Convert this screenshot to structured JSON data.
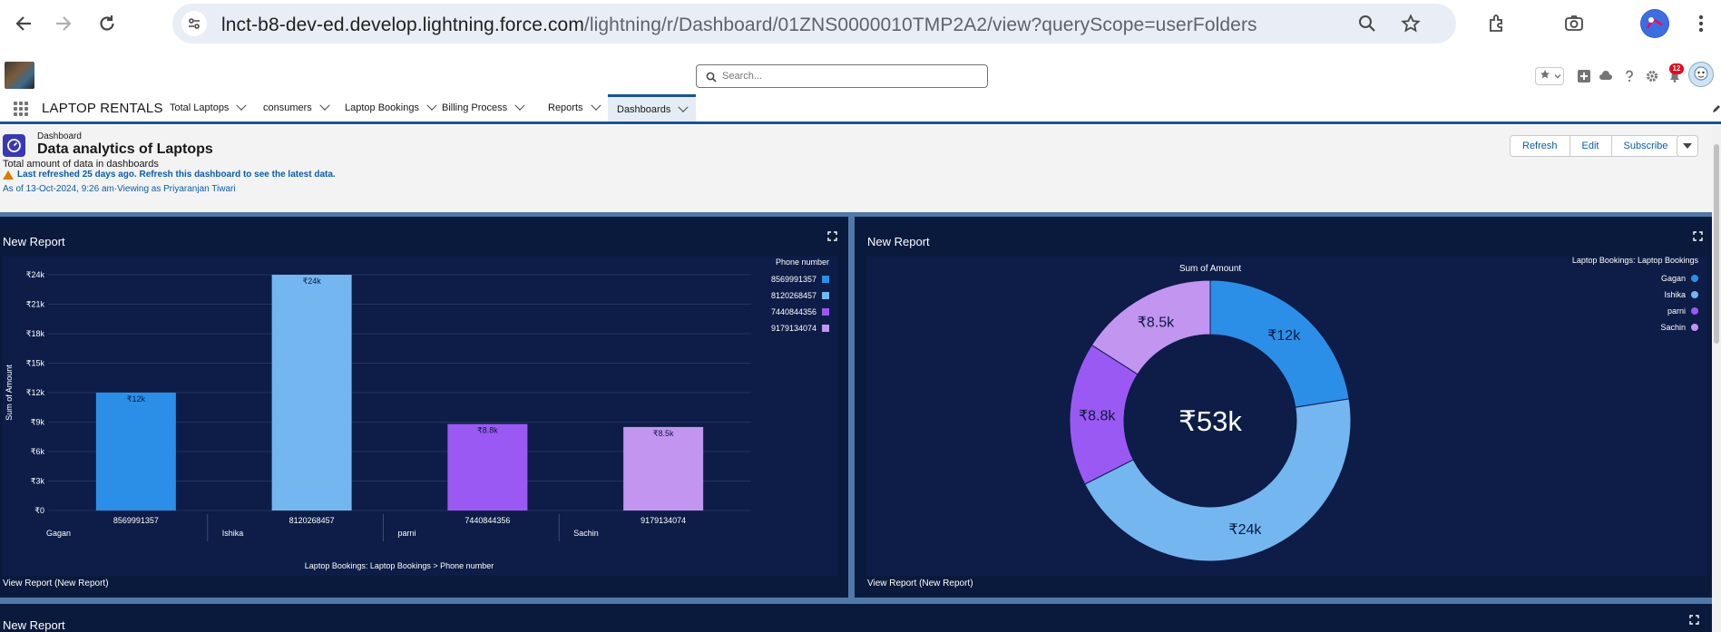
{
  "browser": {
    "url_host": "lnct-b8-dev-ed.develop.lightning.force.com",
    "url_path": "/lightning/r/Dashboard/01ZNS0000010TMP2A2/view?queryScope=userFolders"
  },
  "header": {
    "search_placeholder": "Search...",
    "notification_count": "12"
  },
  "app_nav": {
    "app_name": "LAPTOP RENTALS",
    "tabs": [
      {
        "label": "Total Laptops"
      },
      {
        "label": "consumers"
      },
      {
        "label": "Laptop Bookings"
      },
      {
        "label": "Billing Process"
      },
      {
        "label": "Reports"
      },
      {
        "label": "Dashboards"
      }
    ]
  },
  "dashboard": {
    "kind": "Dashboard",
    "title": "Data analytics of Laptops",
    "description": "Total amount of data in dashboards",
    "warning": "Last refreshed 25 days ago. Refresh this dashboard to see the latest data.",
    "as_of": "As of 13-Oct-2024, 9:26 am·Viewing as Priyaranjan Tiwari",
    "buttons": {
      "refresh": "Refresh",
      "edit": "Edit",
      "subscribe": "Subscribe"
    }
  },
  "widgets": {
    "bar": {
      "title": "New Report",
      "footer": "View Report (New Report)"
    },
    "donut": {
      "title": "New Report",
      "footer": "View Report (New Report)"
    },
    "third": {
      "title": "New Report"
    }
  },
  "colors": {
    "series": [
      "#2b8fe8",
      "#73b6f0",
      "#9b59f3",
      "#c295f0"
    ],
    "widget_bg": "#0a1a3d",
    "plot_bg": "#0d1d48",
    "canvas_bg": "#4f79a8",
    "brand": "#1b5297"
  },
  "chart_data": [
    {
      "type": "bar",
      "ylabel": "Sum of Amount",
      "xlabel": "Laptop Bookings: Laptop Bookings  >  Phone number",
      "legend_title": "Phone number",
      "legend_position": "top-right",
      "ylim": [
        0,
        24000
      ],
      "yticks": [
        "₹0",
        "₹3k",
        "₹6k",
        "₹9k",
        "₹12k",
        "₹15k",
        "₹18k",
        "₹21k",
        "₹24k"
      ],
      "categories": [
        "8569991357",
        "8120268457",
        "7440844356",
        "9179134074"
      ],
      "groups": [
        "Gagan",
        "Ishika",
        "parni",
        "Sachin"
      ],
      "values": [
        12000,
        24000,
        8800,
        8500
      ],
      "data_labels": [
        "₹12k",
        "₹24k",
        "₹8.8k",
        "₹8.5k"
      ],
      "grid": true
    },
    {
      "type": "pie",
      "title": "Sum of Amount",
      "legend_title": "Laptop Bookings: Laptop Bookings",
      "legend_position": "top-right",
      "center_label": "₹53k",
      "categories": [
        "Gagan",
        "Ishika",
        "parni",
        "Sachin"
      ],
      "values": [
        12000,
        24000,
        8800,
        8500
      ],
      "data_labels": [
        "₹12k",
        "₹24k",
        "₹8.8k",
        "₹8.5k"
      ]
    }
  ]
}
